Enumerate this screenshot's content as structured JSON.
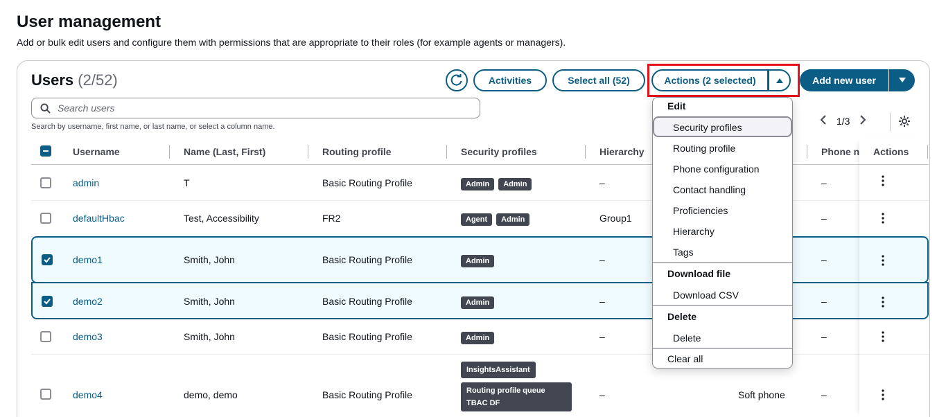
{
  "page": {
    "title": "User management",
    "description": "Add or bulk edit users and configure them with permissions that are appropriate to their roles (for example agents or managers)."
  },
  "users_panel": {
    "title": "Users",
    "count": "(2/52)",
    "buttons": {
      "activities": "Activities",
      "select_all": "Select all (52)",
      "actions": "Actions (2 selected)",
      "add_new_user": "Add new user"
    },
    "search": {
      "placeholder": "Search users",
      "hint": "Search by username, first name, or last name, or select a column name."
    },
    "pagination": {
      "page": "1/3"
    }
  },
  "table": {
    "columns": [
      "Username",
      "Name (Last, First)",
      "Routing profile",
      "Security profiles",
      "Hierarchy",
      "Phone n",
      "Actions"
    ],
    "rows": [
      {
        "username": "admin",
        "name": "T",
        "routing": "Basic Routing Profile",
        "security": [
          "Admin",
          "Admin"
        ],
        "hierarchy": "–",
        "phone_type": "",
        "phone": "–",
        "selected": false
      },
      {
        "username": "defaultHbac",
        "name": "Test, Accessibility",
        "routing": "FR2",
        "security": [
          "Agent",
          "Admin"
        ],
        "hierarchy": "Group1",
        "phone_type": "",
        "phone": "–",
        "selected": false
      },
      {
        "username": "demo1",
        "name": "Smith, John",
        "routing": "Basic Routing Profile",
        "security": [
          "Admin"
        ],
        "hierarchy": "–",
        "phone_type": "",
        "phone": "–",
        "selected": true
      },
      {
        "username": "demo2",
        "name": "Smith, John",
        "routing": "Basic Routing Profile",
        "security": [
          "Admin"
        ],
        "hierarchy": "–",
        "phone_type": "",
        "phone": "–",
        "selected": true
      },
      {
        "username": "demo3",
        "name": "Smith, John",
        "routing": "Basic Routing Profile",
        "security": [
          "Admin"
        ],
        "hierarchy": "–",
        "phone_type": "",
        "phone": "–",
        "selected": false
      },
      {
        "username": "demo4",
        "name": "demo, demo",
        "routing": "Basic Routing Profile",
        "security": [
          "InsightsAssistant",
          "Routing profile queue TBAC DF"
        ],
        "hierarchy": "–",
        "phone_type": "Soft phone",
        "phone": "–",
        "selected": false
      }
    ]
  },
  "actions_menu": {
    "groups": [
      {
        "label": "Edit",
        "items": [
          "Security profiles",
          "Routing profile",
          "Phone configuration",
          "Contact handling",
          "Proficiencies",
          "Hierarchy",
          "Tags"
        ]
      },
      {
        "label": "Download file",
        "items": [
          "Download CSV"
        ]
      },
      {
        "label": "Delete",
        "items": [
          "Delete"
        ]
      }
    ],
    "clear_all": "Clear all"
  },
  "colors": {
    "primary": "#0b5d85",
    "highlight": "#e5101a",
    "badge": "#424650"
  }
}
